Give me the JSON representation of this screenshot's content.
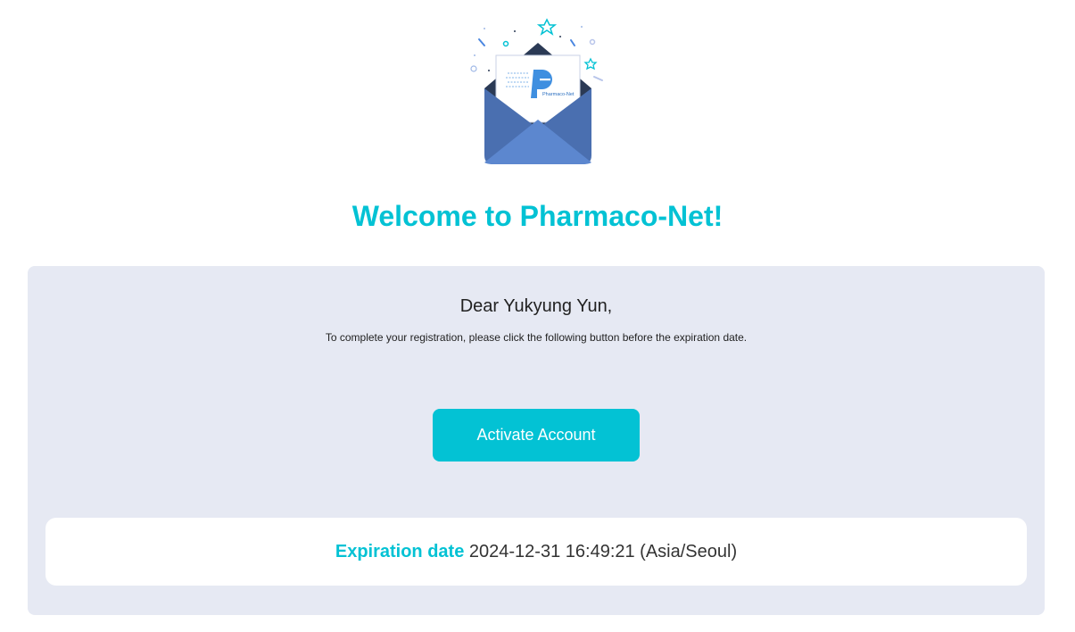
{
  "hero": {
    "logo_text": "Pharmaco-Net"
  },
  "title": "Welcome to Pharmaco-Net!",
  "panel": {
    "greeting": "Dear Yukyung Yun,",
    "instruction": "To complete your registration, please click the following button before the expiration date.",
    "button_label": "Activate Account",
    "expiration": {
      "label": "Expiration date",
      "value": "2024-12-31 16:49:21 (Asia/Seoul)"
    }
  },
  "colors": {
    "accent": "#03c2d4",
    "panel_bg": "#e6e9f3",
    "envelope_blue": "#4a6fb0",
    "envelope_dark": "#2b3a55"
  },
  "icons": {
    "hero": "envelope-icon"
  }
}
